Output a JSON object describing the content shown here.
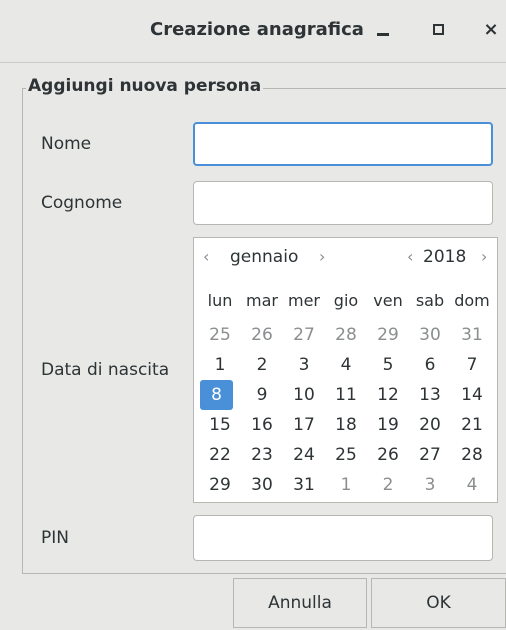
{
  "window": {
    "title": "Creazione anagrafica",
    "controls": {
      "minimize": "–",
      "maximize": "□",
      "close": "×"
    }
  },
  "form": {
    "legend": "Aggiungi nuova persona",
    "fields": {
      "nome": {
        "label": "Nome",
        "value": ""
      },
      "cognome": {
        "label": "Cognome",
        "value": ""
      },
      "data_nascita": {
        "label": "Data di nascita"
      },
      "pin": {
        "label": "PIN",
        "value": ""
      }
    },
    "calendar": {
      "prev_month": "‹",
      "next_month": "›",
      "month": "gennaio",
      "prev_year": "‹",
      "next_year": "›",
      "year": "2018",
      "weekdays": [
        "lun",
        "mar",
        "mer",
        "gio",
        "ven",
        "sab",
        "dom"
      ],
      "weeks": [
        [
          {
            "d": "25",
            "o": true
          },
          {
            "d": "26",
            "o": true
          },
          {
            "d": "27",
            "o": true
          },
          {
            "d": "28",
            "o": true
          },
          {
            "d": "29",
            "o": true
          },
          {
            "d": "30",
            "o": true
          },
          {
            "d": "31",
            "o": true
          }
        ],
        [
          {
            "d": "1"
          },
          {
            "d": "2"
          },
          {
            "d": "3"
          },
          {
            "d": "4"
          },
          {
            "d": "5"
          },
          {
            "d": "6"
          },
          {
            "d": "7"
          }
        ],
        [
          {
            "d": "8",
            "s": true
          },
          {
            "d": "9"
          },
          {
            "d": "10"
          },
          {
            "d": "11"
          },
          {
            "d": "12"
          },
          {
            "d": "13"
          },
          {
            "d": "14"
          }
        ],
        [
          {
            "d": "15"
          },
          {
            "d": "16"
          },
          {
            "d": "17"
          },
          {
            "d": "18"
          },
          {
            "d": "19"
          },
          {
            "d": "20"
          },
          {
            "d": "21"
          }
        ],
        [
          {
            "d": "22"
          },
          {
            "d": "23"
          },
          {
            "d": "24"
          },
          {
            "d": "25"
          },
          {
            "d": "26"
          },
          {
            "d": "27"
          },
          {
            "d": "28"
          }
        ],
        [
          {
            "d": "29"
          },
          {
            "d": "30"
          },
          {
            "d": "31"
          },
          {
            "d": "1",
            "o": true
          },
          {
            "d": "2",
            "o": true
          },
          {
            "d": "3",
            "o": true
          },
          {
            "d": "4",
            "o": true
          }
        ]
      ]
    }
  },
  "buttons": {
    "cancel": "Annulla",
    "ok": "OK"
  },
  "colors": {
    "accent": "#4a90d9",
    "background": "#e8e8e7",
    "text": "#2e3436",
    "muted": "#8b8e8f"
  }
}
